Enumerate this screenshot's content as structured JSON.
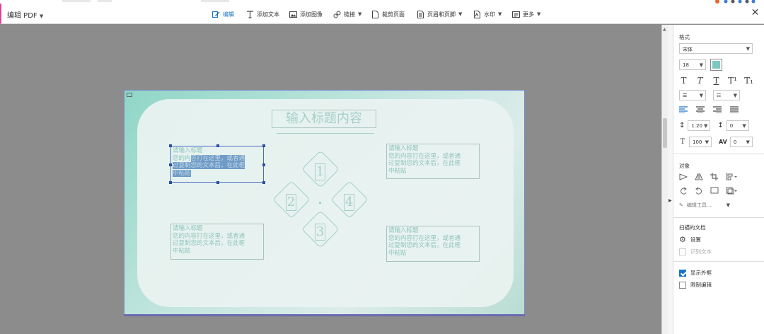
{
  "toolbar": {
    "mode_label": "编辑 PDF",
    "items": [
      {
        "label": "编辑",
        "icon": "edit-icon"
      },
      {
        "label": "添加文本",
        "icon": "text-icon"
      },
      {
        "label": "添加图像",
        "icon": "image-icon"
      },
      {
        "label": "链接",
        "icon": "link-icon"
      },
      {
        "label": "裁剪页面",
        "icon": "crop-page-icon"
      },
      {
        "label": "页眉和页脚",
        "icon": "header-footer-icon"
      },
      {
        "label": "水印",
        "icon": "watermark-icon"
      },
      {
        "label": "更多",
        "icon": "more-icon"
      }
    ]
  },
  "slide": {
    "title": "输入标题内容",
    "boxes": [
      {
        "heading": "请输入标题",
        "line1a": "您的内",
        "line1b": "容打在这里，或者通",
        "line2": "过复制您的文本后，在此框",
        "line3": "中粘贴"
      },
      {
        "heading": "请输入标题",
        "line1": "您的内容打在这里，或者通",
        "line2": "过复制您的文本后，在此框",
        "line3": "中粘贴"
      },
      {
        "heading": "请输入标题",
        "line1": "您的内容打在这里，或者通",
        "line2": "过复制您的文本后，在此框",
        "line3": "中粘贴"
      },
      {
        "heading": "请输入标题",
        "line1": "您的内容打在这里，或者通",
        "line2": "过复制您的文本后，在此框",
        "line3": "中粘贴"
      }
    ],
    "numbers": [
      "1",
      "2",
      "4",
      "3"
    ]
  },
  "panel": {
    "format_heading": "格式",
    "font_family": "宋体",
    "font_size": "18",
    "text_color": "#7ec8c0",
    "line_spacing": "1.20",
    "paragraph_spacing": "0",
    "horizontal_scale": "100",
    "char_spacing": "0",
    "object_heading": "对象",
    "edit_tool_label": "编辑工具...",
    "scanned_heading": "扫描的文档",
    "settings_label": "设置",
    "recognize_label": "识别文本",
    "show_bbox_label": "显示外框",
    "show_bbox_checked": true,
    "restrict_label": "限制编辑",
    "restrict_checked": false
  }
}
